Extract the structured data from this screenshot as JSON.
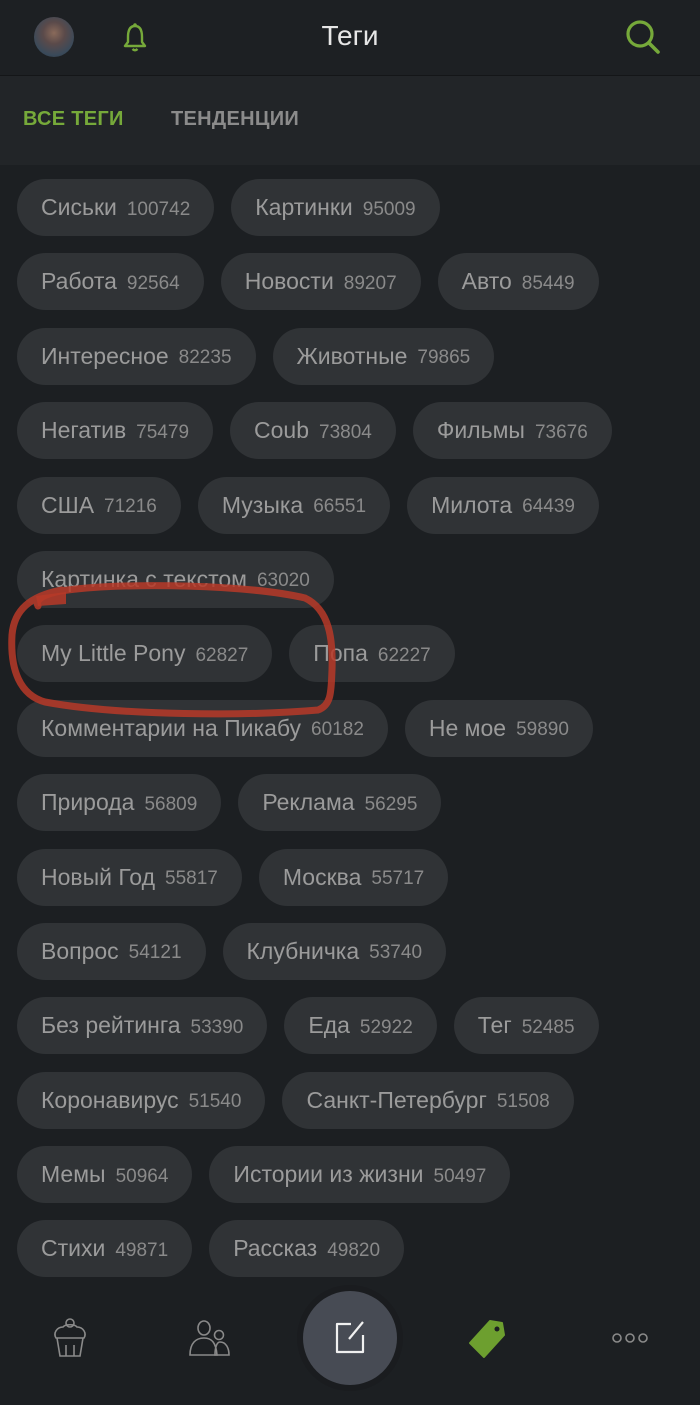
{
  "header": {
    "title": "Теги",
    "icons": [
      "avatar",
      "bell-icon",
      "search-icon"
    ]
  },
  "tabs": [
    {
      "label": "ВСЕ ТЕГИ",
      "active": true
    },
    {
      "label": "ТЕНДЕНЦИИ",
      "active": false
    }
  ],
  "tag_rows": [
    [
      {
        "name": "Сиськи",
        "count": "100742"
      },
      {
        "name": "Картинки",
        "count": "95009"
      }
    ],
    [
      {
        "name": "Работа",
        "count": "92564"
      },
      {
        "name": "Новости",
        "count": "89207"
      },
      {
        "name": "Авто",
        "count": "85449"
      }
    ],
    [
      {
        "name": "Интересное",
        "count": "82235"
      },
      {
        "name": "Животные",
        "count": "79865"
      }
    ],
    [
      {
        "name": "Негатив",
        "count": "75479"
      },
      {
        "name": "Coub",
        "count": "73804"
      },
      {
        "name": "Фильмы",
        "count": "73676"
      }
    ],
    [
      {
        "name": "США",
        "count": "71216"
      },
      {
        "name": "Музыка",
        "count": "66551"
      },
      {
        "name": "Милота",
        "count": "64439"
      }
    ],
    [
      {
        "name": "Картинка с текстом",
        "count": "63020"
      }
    ],
    [
      {
        "name": "My Little Pony",
        "count": "62827"
      },
      {
        "name": "Попа",
        "count": "62227"
      }
    ],
    [
      {
        "name": "Комментарии на Пикабу",
        "count": "60182"
      },
      {
        "name": "Не мое",
        "count": "59890"
      }
    ],
    [
      {
        "name": "Природа",
        "count": "56809"
      },
      {
        "name": "Реклама",
        "count": "56295"
      }
    ],
    [
      {
        "name": "Новый Год",
        "count": "55817"
      },
      {
        "name": "Москва",
        "count": "55717"
      }
    ],
    [
      {
        "name": "Вопрос",
        "count": "54121"
      },
      {
        "name": "Клубничка",
        "count": "53740"
      }
    ],
    [
      {
        "name": "Без рейтинга",
        "count": "53390"
      },
      {
        "name": "Еда",
        "count": "52922"
      },
      {
        "name": "Тег",
        "count": "52485"
      }
    ],
    [
      {
        "name": "Коронавирус",
        "count": "51540"
      },
      {
        "name": "Санкт-Петербург",
        "count": "51508"
      }
    ],
    [
      {
        "name": "Мемы",
        "count": "50964"
      },
      {
        "name": "Истории из жизни",
        "count": "50497"
      }
    ],
    [
      {
        "name": "Стихи",
        "count": "49871"
      },
      {
        "name": "Рассказ",
        "count": "49820"
      }
    ]
  ],
  "highlighted_tag": "My Little Pony",
  "bottom_nav": {
    "items": [
      "cupcake-icon",
      "community-icon",
      "compose-icon",
      "tag-icon",
      "more-icon"
    ],
    "active": "tag-icon"
  },
  "colors": {
    "accent": "#76a93a",
    "background": "#1c1f22",
    "chip": "#303336",
    "annotation": "#b73a28"
  }
}
